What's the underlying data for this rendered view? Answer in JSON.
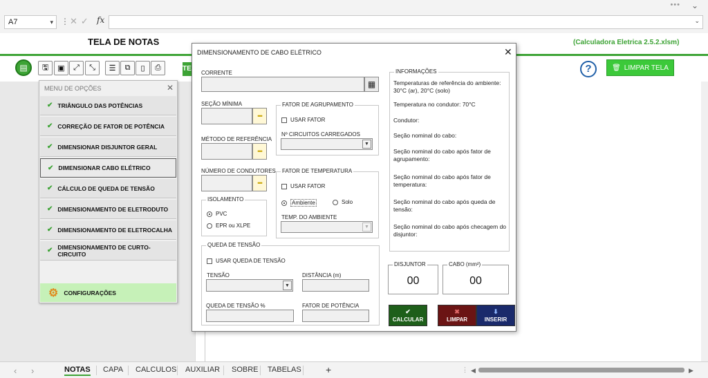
{
  "formula_bar": {
    "name_box": "A7",
    "fx": "fx",
    "formula": ""
  },
  "header": {
    "title": "TELA DE NOTAS",
    "version": "(Calculadora Eletrica 2.5.2.xlsm)",
    "te_tab": "TE",
    "limpar_tela": "LIMPAR TELA",
    "help": "?"
  },
  "menu": {
    "title": "MENU DE OPÇÕES",
    "items": [
      {
        "label": "TRIÂNGULO DAS POTÊNCIAS"
      },
      {
        "label": "CORREÇÃO DE FATOR DE POTÊNCIA"
      },
      {
        "label": "DIMENSIONAR DISJUNTOR GERAL"
      },
      {
        "label": "DIMENSIONAR CABO ELÉTRICO"
      },
      {
        "label": "CÁLCULO DE QUEDA DE TENSÃO"
      },
      {
        "label": "DIMENSIONAMENTO DE ELETRODUTO"
      },
      {
        "label": "DIMENSIONAMENTO DE ELETROCALHA"
      },
      {
        "label": "DIMENSIONAMENTO DE CURTO-CIRCUITO"
      }
    ],
    "selected_index": 3,
    "config_label": "CONFIGURAÇÕES"
  },
  "dialog": {
    "title": "DIMENSIONAMENTO DE CABO ELÉTRICO",
    "corrente": {
      "label": "CORRENTE",
      "value": ""
    },
    "secao_minima": {
      "label": "SEÇÃO MÍNIMA",
      "value": ""
    },
    "metodo_referencia": {
      "label": "MÉTODO DE REFERÊNCIA",
      "value": ""
    },
    "numero_condutores": {
      "label": "NÚMERO DE CONDUTORES",
      "value": ""
    },
    "dots": "•••",
    "isolamento": {
      "label": "ISOLAMENTO",
      "opt1": "PVC",
      "opt2": "EPR ou XLPE",
      "selected": "PVC"
    },
    "fator_agrupamento": {
      "label": "FATOR DE AGRUPAMENTO",
      "checkbox": "USAR FATOR",
      "circuitos_label": "Nº CIRCUITOS CARREGADOS"
    },
    "fator_temperatura": {
      "label": "FATOR DE TEMPERATURA",
      "checkbox": "USAR FATOR",
      "opt1": "Ambiente",
      "opt2": "Solo",
      "selected": "Ambiente",
      "temp_label": "TEMP. DO AMBIENTE"
    },
    "queda_tensao": {
      "label": "QUEDA DE TENSÃO",
      "checkbox": "USAR QUEDA DE TENSÃO",
      "tensao_label": "TENSÃO",
      "distancia_label": "DISTÂNCIA (m)",
      "queda_label": "QUEDA DE TENSÃO %",
      "fp_label": "FATOR DE POTÊNCIA"
    },
    "informacoes": {
      "label": "INFORMAÇÕES",
      "lines": [
        "Temperaturas de referência do ambiente: 30°C (ar), 20°C (solo)",
        "Temperatura no condutor: 70°C",
        "Condutor:",
        "Seção nominal do cabo:",
        "Seção nominal do cabo após fator de agrupamento:",
        "Seção nominal do cabo após fator de temperatura:",
        "Seção nominal do cabo após queda de tensão:",
        "Seção nominal do cabo após checagem do disjuntor:"
      ]
    },
    "disjuntor": {
      "label": "DISJUNTOR",
      "value": "00"
    },
    "cabo": {
      "label": "CABO (mm²)",
      "value": "00"
    },
    "buttons": {
      "calcular": "CALCULAR",
      "limpar": "LIMPAR",
      "inserir": "INSERIR"
    },
    "colors": {
      "calcular": "#1e5f1a",
      "limpar": "#6b1414",
      "inserir": "#1a2a6b"
    }
  },
  "tabs": [
    "NOTAS",
    "CAPA",
    "CALCULOS",
    "AUXILIAR",
    "SOBRE",
    "TABELAS"
  ],
  "active_tab": "NOTAS",
  "colors": {
    "accent": "#3da335",
    "limpar_tela": "#3cc93a"
  }
}
